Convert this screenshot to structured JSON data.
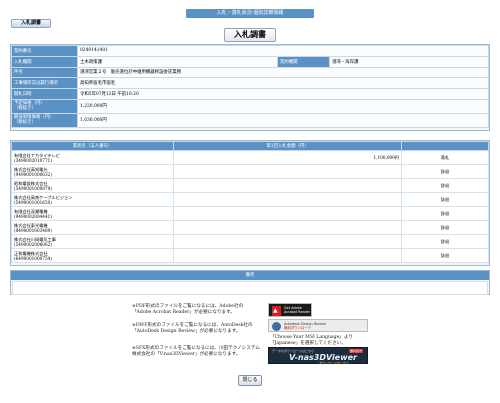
{
  "header": {
    "banner": "入札・落札状況-個別詳細情報",
    "tab_label": "入札調書",
    "page_title": "入札調書"
  },
  "info": {
    "rows": [
      {
        "label": "契約番号",
        "value": "0240141401"
      },
      {
        "label": "入札機関",
        "value": "土木政策課",
        "label2": "契約機関",
        "value2": "港湾・海岸課"
      },
      {
        "label": "件名",
        "value": "港湾営業２号　販売港位計中継用機器移設委託業務"
      },
      {
        "label": "工事場所又は履行場所",
        "value": "高知県宿毛市宿毛"
      },
      {
        "label": "開札日時",
        "value": "令和5年07月12日 午前10:20"
      },
      {
        "label": "予定価格（円）\n（税抜き）",
        "value": "1,220,000円"
      },
      {
        "label": "最低制限価格（円）\n（税抜き）",
        "value": "1,030,000円"
      }
    ]
  },
  "bids": {
    "col_name": "業者名（法人番号）",
    "col_amount": "第1回入札金額（円）",
    "col_result": "",
    "rows": [
      {
        "name": "有限会社ナカタイテレビ",
        "num": "(3490002010771)",
        "amount": "1,100,000円",
        "result": "落札"
      },
      {
        "name": "株式会社高知電光",
        "num": "(9490001000632)",
        "amount": "",
        "result": "辞退"
      },
      {
        "name": "昭和電設株式会社",
        "num": "(5490001000879)",
        "amount": "",
        "result": "辞退"
      },
      {
        "name": "株式会社高南ケーブルビジョン",
        "num": "(5490001001650)",
        "amount": "",
        "result": "辞退"
      },
      {
        "name": "有限会社深瀬電機",
        "num": "(9490002004441)",
        "amount": "",
        "result": "辞退"
      },
      {
        "name": "株式会社東光電機",
        "num": "(8490001003489)",
        "amount": "",
        "result": "辞退"
      },
      {
        "name": "株式会社川岡電気工事",
        "num": "(5490002006062)",
        "amount": "",
        "result": "辞退"
      },
      {
        "name": "正和電機株式会社",
        "num": "(6490001000754)",
        "amount": "",
        "result": "辞退"
      }
    ]
  },
  "remarks": {
    "label": "備考",
    "value": ""
  },
  "notes": {
    "pdf": "※PDF形式のファイルをご覧になるには、Adobe社の「Adobe Acrobat Reader」が必要になります。",
    "dwf": "※DWF形式のファイルをご覧になるには、AutoDesk社の「AutoDesk Design Review」が必要になります。",
    "dwf_lang": "「Choose Your MSI Language」より「Japanese」を選択してください。",
    "sfx": "※SFX形式のファイルをご覧になるには、川田テクノシステム株式会社の「V-nas3DViewer」が必要になります。"
  },
  "badges": {
    "adobe_line1": "Get Adobe",
    "adobe_line2": "Acrobat Reader",
    "adsk_line1": "Autodesk Design Review",
    "adsk_line2": "無料ダウンロード",
    "v3d_small": "データのダウンロードはこちら",
    "v3d_big": "V-nas3DViewer",
    "v3d_dl": "ダウンロードはこちら",
    "v3d_free": "無料配布"
  },
  "footer": {
    "close_label": "閉じる"
  }
}
